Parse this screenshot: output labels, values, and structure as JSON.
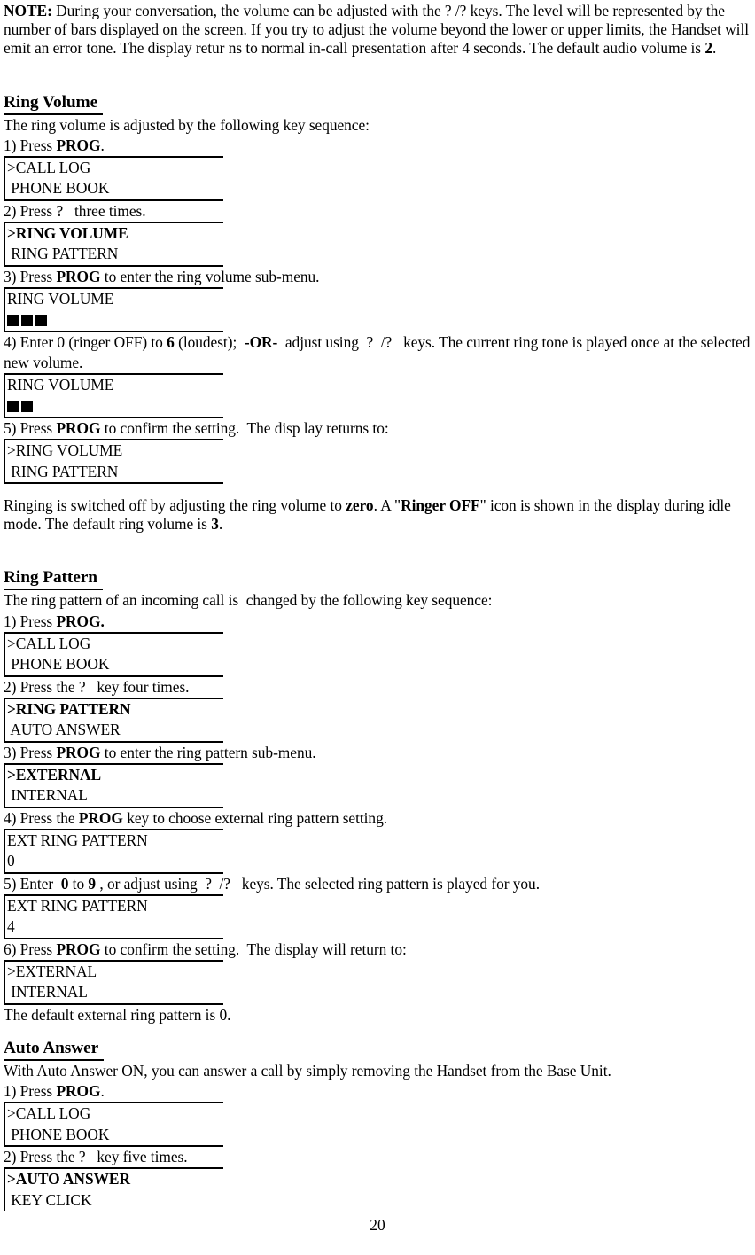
{
  "document": {
    "page_number": "20",
    "note": {
      "label": "NOTE:",
      "body": " During your conversation, the volume can be adjusted with the ?  /?   keys. The level will be represented by the number of bars displayed on the screen. If you try to adjust the volume beyond the lower or upper limits, the Handset will emit an error tone. The display retur ns to normal in-call presentation after 4 seconds.  The default audio volume is ",
      "default_value": "2",
      "tail": "."
    },
    "sections": [
      {
        "id": "ring-volume",
        "title": "Ring Volume",
        "intro": "The ring volume is adjusted by the following key sequence:",
        "steps": [
          {
            "pre": "1) Press ",
            "bold": "PROG",
            "post": "."
          },
          {
            "pre": "2) Press ?   three times.",
            "bold": "",
            "post": ""
          },
          {
            "pre": "3) Press ",
            "bold": "PROG",
            "post": " to enter the ring volume sub-menu."
          },
          {
            "pre": "4) Enter 0 (ringer OFF) to ",
            "bold": "6",
            "post": " (loudest);  ",
            "bold2": "-OR-",
            "post2": "  adjust using  ?  /?   keys. The current ring tone is played once at the selected new volume."
          },
          {
            "pre": "5) Press ",
            "bold": "PROG",
            "post": " to confirm the setting.  The disp lay returns to:"
          }
        ],
        "displays": [
          {
            "id": "menu-call-log",
            "line1": ">CALL LOG",
            "line2": " PHONE BOOK",
            "line1_bold": false,
            "type": "text"
          },
          {
            "id": "menu-ring-volume",
            "line1": ">RING VOLUME",
            "line2": " RING PATTERN",
            "line1_bold": true,
            "type": "text"
          },
          {
            "id": "ring-volume-3-bars",
            "line1": "RING VOLUME",
            "line1_bold": false,
            "type": "bars",
            "bars": 3
          },
          {
            "id": "ring-volume-2-bars",
            "line1": "RING VOLUME",
            "line1_bold": false,
            "type": "bars",
            "bars": 2
          },
          {
            "id": "menu-ring-volume-return",
            "line1": ">RING VOLUME",
            "line2": " RING PATTERN",
            "line1_bold": false,
            "type": "text"
          }
        ],
        "outro": {
          "pre": "Ringing is switched off by adjusting the ring volume to ",
          "bold1": "zero",
          "mid1": ". A \"",
          "bold2": "Ringer OFF",
          "mid2": "\" icon is shown in the display during idle mode.  The default ring volume is ",
          "bold3": "3",
          "tail": "."
        }
      },
      {
        "id": "ring-pattern",
        "title": "Ring Pattern",
        "intro": "The ring pattern of an incoming call is  changed by the following key sequence:",
        "steps": [
          {
            "pre": "1) Press ",
            "bold": "PROG.",
            "post": ""
          },
          {
            "pre": "2) Press the ?   key four times.",
            "bold": "",
            "post": ""
          },
          {
            "pre": "3) Press ",
            "bold": "PROG",
            "post": " to enter the ring pattern sub-menu."
          },
          {
            "pre": "4) Press the ",
            "bold": "PROG",
            "post": " key to choose external ring pattern setting."
          },
          {
            "pre": "5) Enter  ",
            "bold": "0",
            "post": " to ",
            "bold2": "9",
            "post2": " , or adjust using  ?  /?   keys. The selected ring pattern is played for you."
          },
          {
            "pre": "6) Press ",
            "bold": "PROG",
            "post": " to confirm the setting.  The display will return to:"
          }
        ],
        "displays": [
          {
            "id": "menu-call-log-2",
            "line1": ">CALL LOG",
            "line2": " PHONE BOOK",
            "line1_bold": false,
            "type": "text"
          },
          {
            "id": "menu-ring-pattern",
            "line1": ">RING PATTERN",
            "line2": " AUTO ANSWER",
            "line1_bold": true,
            "type": "text"
          },
          {
            "id": "menu-external",
            "line1": ">EXTERNAL",
            "line2": " INTERNAL",
            "line1_bold": true,
            "type": "text"
          },
          {
            "id": "ext-ring-pattern-0",
            "line1": "EXT RING PATTERN",
            "line2": "0",
            "line1_bold": false,
            "type": "text"
          },
          {
            "id": "ext-ring-pattern-4",
            "line1": "EXT RING PATTERN",
            "line2": "4",
            "line1_bold": false,
            "type": "text"
          },
          {
            "id": "menu-external-return",
            "line1": ">EXTERNAL",
            "line2": " INTERNAL",
            "line1_bold": false,
            "type": "text"
          }
        ],
        "outro_plain": "The default external ring pattern is 0."
      },
      {
        "id": "auto-answer",
        "title": "Auto Answer",
        "intro": "With Auto Answer ON, you can answer a call by simply removing the Handset from the Base Unit.",
        "steps": [
          {
            "pre": "1) Press ",
            "bold": "PROG",
            "post": "."
          },
          {
            "pre": "2) Press the ?   key five times.",
            "bold": "",
            "post": ""
          }
        ],
        "displays": [
          {
            "id": "menu-call-log-3",
            "line1": ">CALL LOG",
            "line2": " PHONE BOOK",
            "line1_bold": false,
            "type": "text"
          },
          {
            "id": "menu-auto-answer",
            "line1": ">AUTO ANSWER",
            "line2": " KEY CLICK",
            "line1_bold": true,
            "type": "text"
          }
        ]
      }
    ]
  }
}
